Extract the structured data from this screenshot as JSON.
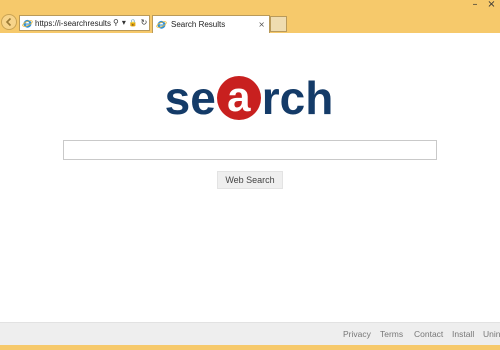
{
  "window": {
    "minimize_glyph": "–",
    "close_glyph": "×"
  },
  "address_bar": {
    "url": "https://i-searchresults...",
    "search_glyph": "⚲",
    "dropdown_glyph": "▾",
    "lock_glyph": "🔒",
    "refresh_glyph": "↻"
  },
  "tab": {
    "title": "Search Results",
    "close_glyph": "×"
  },
  "logo": {
    "left": "se",
    "middle": "a",
    "right": "rch",
    "text_color": "#143b68",
    "accent_color": "#c8201f"
  },
  "search": {
    "value": "",
    "button_label": "Web Search"
  },
  "footer": {
    "links": [
      "Privacy",
      "Terms",
      "Contact",
      "Install",
      "Unin"
    ]
  },
  "colors": {
    "chrome": "#f6c96b",
    "footer_bg": "#eeeeee"
  }
}
